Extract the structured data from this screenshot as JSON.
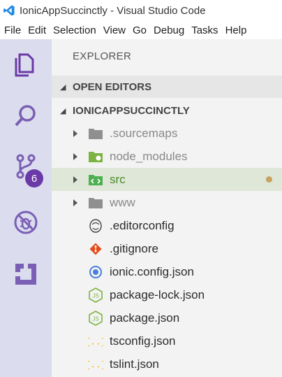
{
  "window": {
    "title": "IonicAppSuccinctly - Visual Studio Code",
    "app_logo": "vscode-icon"
  },
  "menu": [
    "File",
    "Edit",
    "Selection",
    "View",
    "Go",
    "Debug",
    "Tasks",
    "Help"
  ],
  "activity_bar": {
    "items": [
      "explorer-icon",
      "search-icon",
      "source-control-icon",
      "debug-icon",
      "extensions-icon"
    ],
    "scm_badge": "6",
    "colors": {
      "active_icon": "#6a3aa6",
      "inactive_icon": "#7a5fb4",
      "badge": "#6a3aa6"
    }
  },
  "sidebar": {
    "title": "EXPLORER",
    "sections": {
      "open_editors": "OPEN EDITORS",
      "project": "IONICAPPSUCCINCTLY"
    },
    "tree": [
      {
        "name": ".sourcemaps",
        "type": "folder",
        "icon": "folder-icon"
      },
      {
        "name": "node_modules",
        "type": "folder",
        "icon": "node-folder-icon"
      },
      {
        "name": "src",
        "type": "folder",
        "icon": "src-folder-icon",
        "selected": true,
        "modified": true
      },
      {
        "name": "www",
        "type": "folder",
        "icon": "folder-icon"
      },
      {
        "name": ".editorconfig",
        "type": "file",
        "icon": "editorconfig-icon"
      },
      {
        "name": ".gitignore",
        "type": "file",
        "icon": "git-icon"
      },
      {
        "name": "ionic.config.json",
        "type": "file",
        "icon": "ionic-icon"
      },
      {
        "name": "package-lock.json",
        "type": "file",
        "icon": "nodejs-icon"
      },
      {
        "name": "package.json",
        "type": "file",
        "icon": "nodejs-icon"
      },
      {
        "name": "tsconfig.json",
        "type": "file",
        "icon": "json-icon"
      },
      {
        "name": "tslint.json",
        "type": "file",
        "icon": "json-icon"
      }
    ]
  }
}
